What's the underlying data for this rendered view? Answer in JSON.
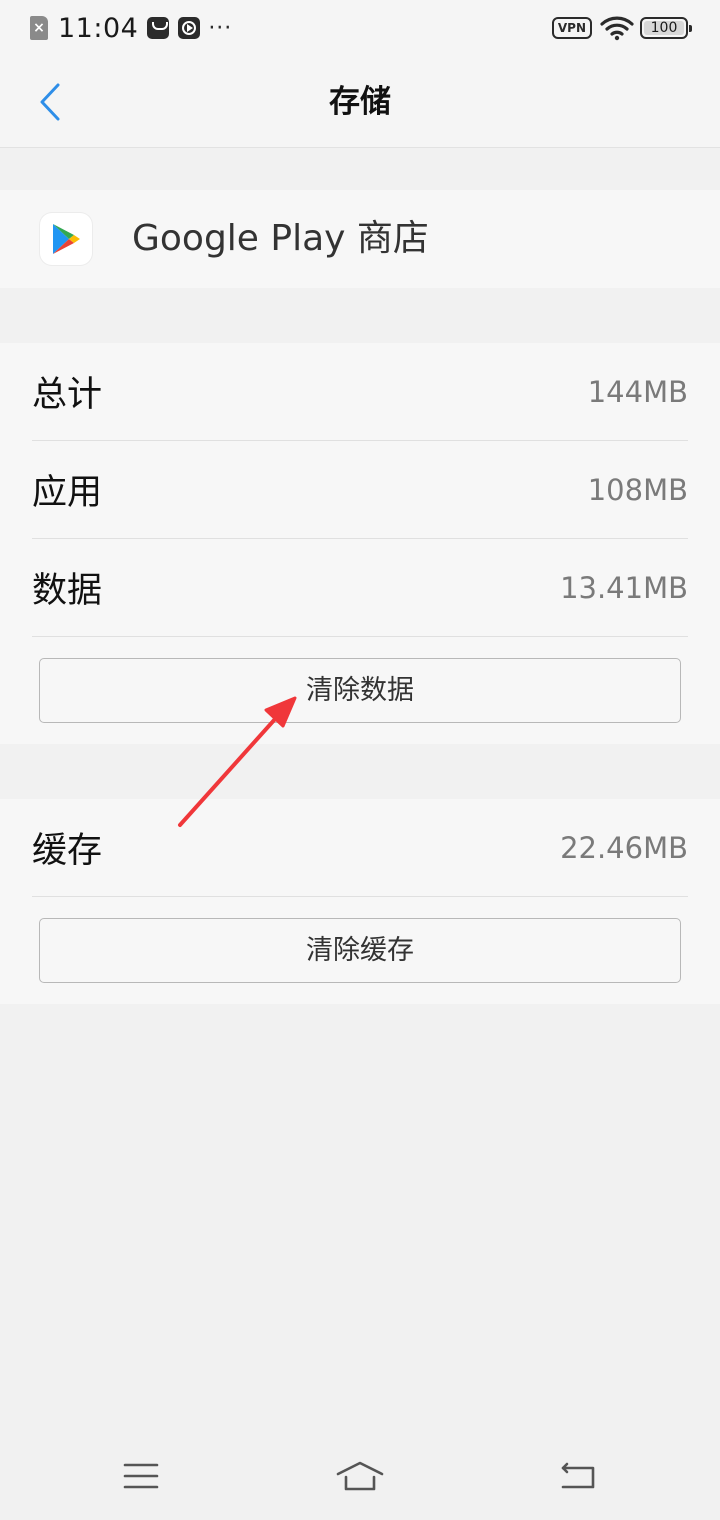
{
  "status_bar": {
    "time": "11:04",
    "more": "···",
    "vpn_label": "VPN",
    "battery_level": "100"
  },
  "header": {
    "title": "存储"
  },
  "app": {
    "name": "Google Play 商店"
  },
  "storage": {
    "rows": [
      {
        "label": "总计",
        "value": "144MB"
      },
      {
        "label": "应用",
        "value": "108MB"
      },
      {
        "label": "数据",
        "value": "13.41MB"
      }
    ],
    "clear_data_label": "清除数据"
  },
  "cache": {
    "label": "缓存",
    "value": "22.46MB",
    "clear_cache_label": "清除缓存"
  },
  "colors": {
    "accent": "#2e8ee8",
    "annotation_arrow": "#f0373a",
    "background": "#f1f1f1",
    "card": "#f7f7f7"
  },
  "icons": {
    "back": "chevron-left-icon",
    "app": "google-play-icon",
    "nav_menu": "menu-icon",
    "nav_home": "home-icon",
    "nav_back": "back-icon"
  }
}
